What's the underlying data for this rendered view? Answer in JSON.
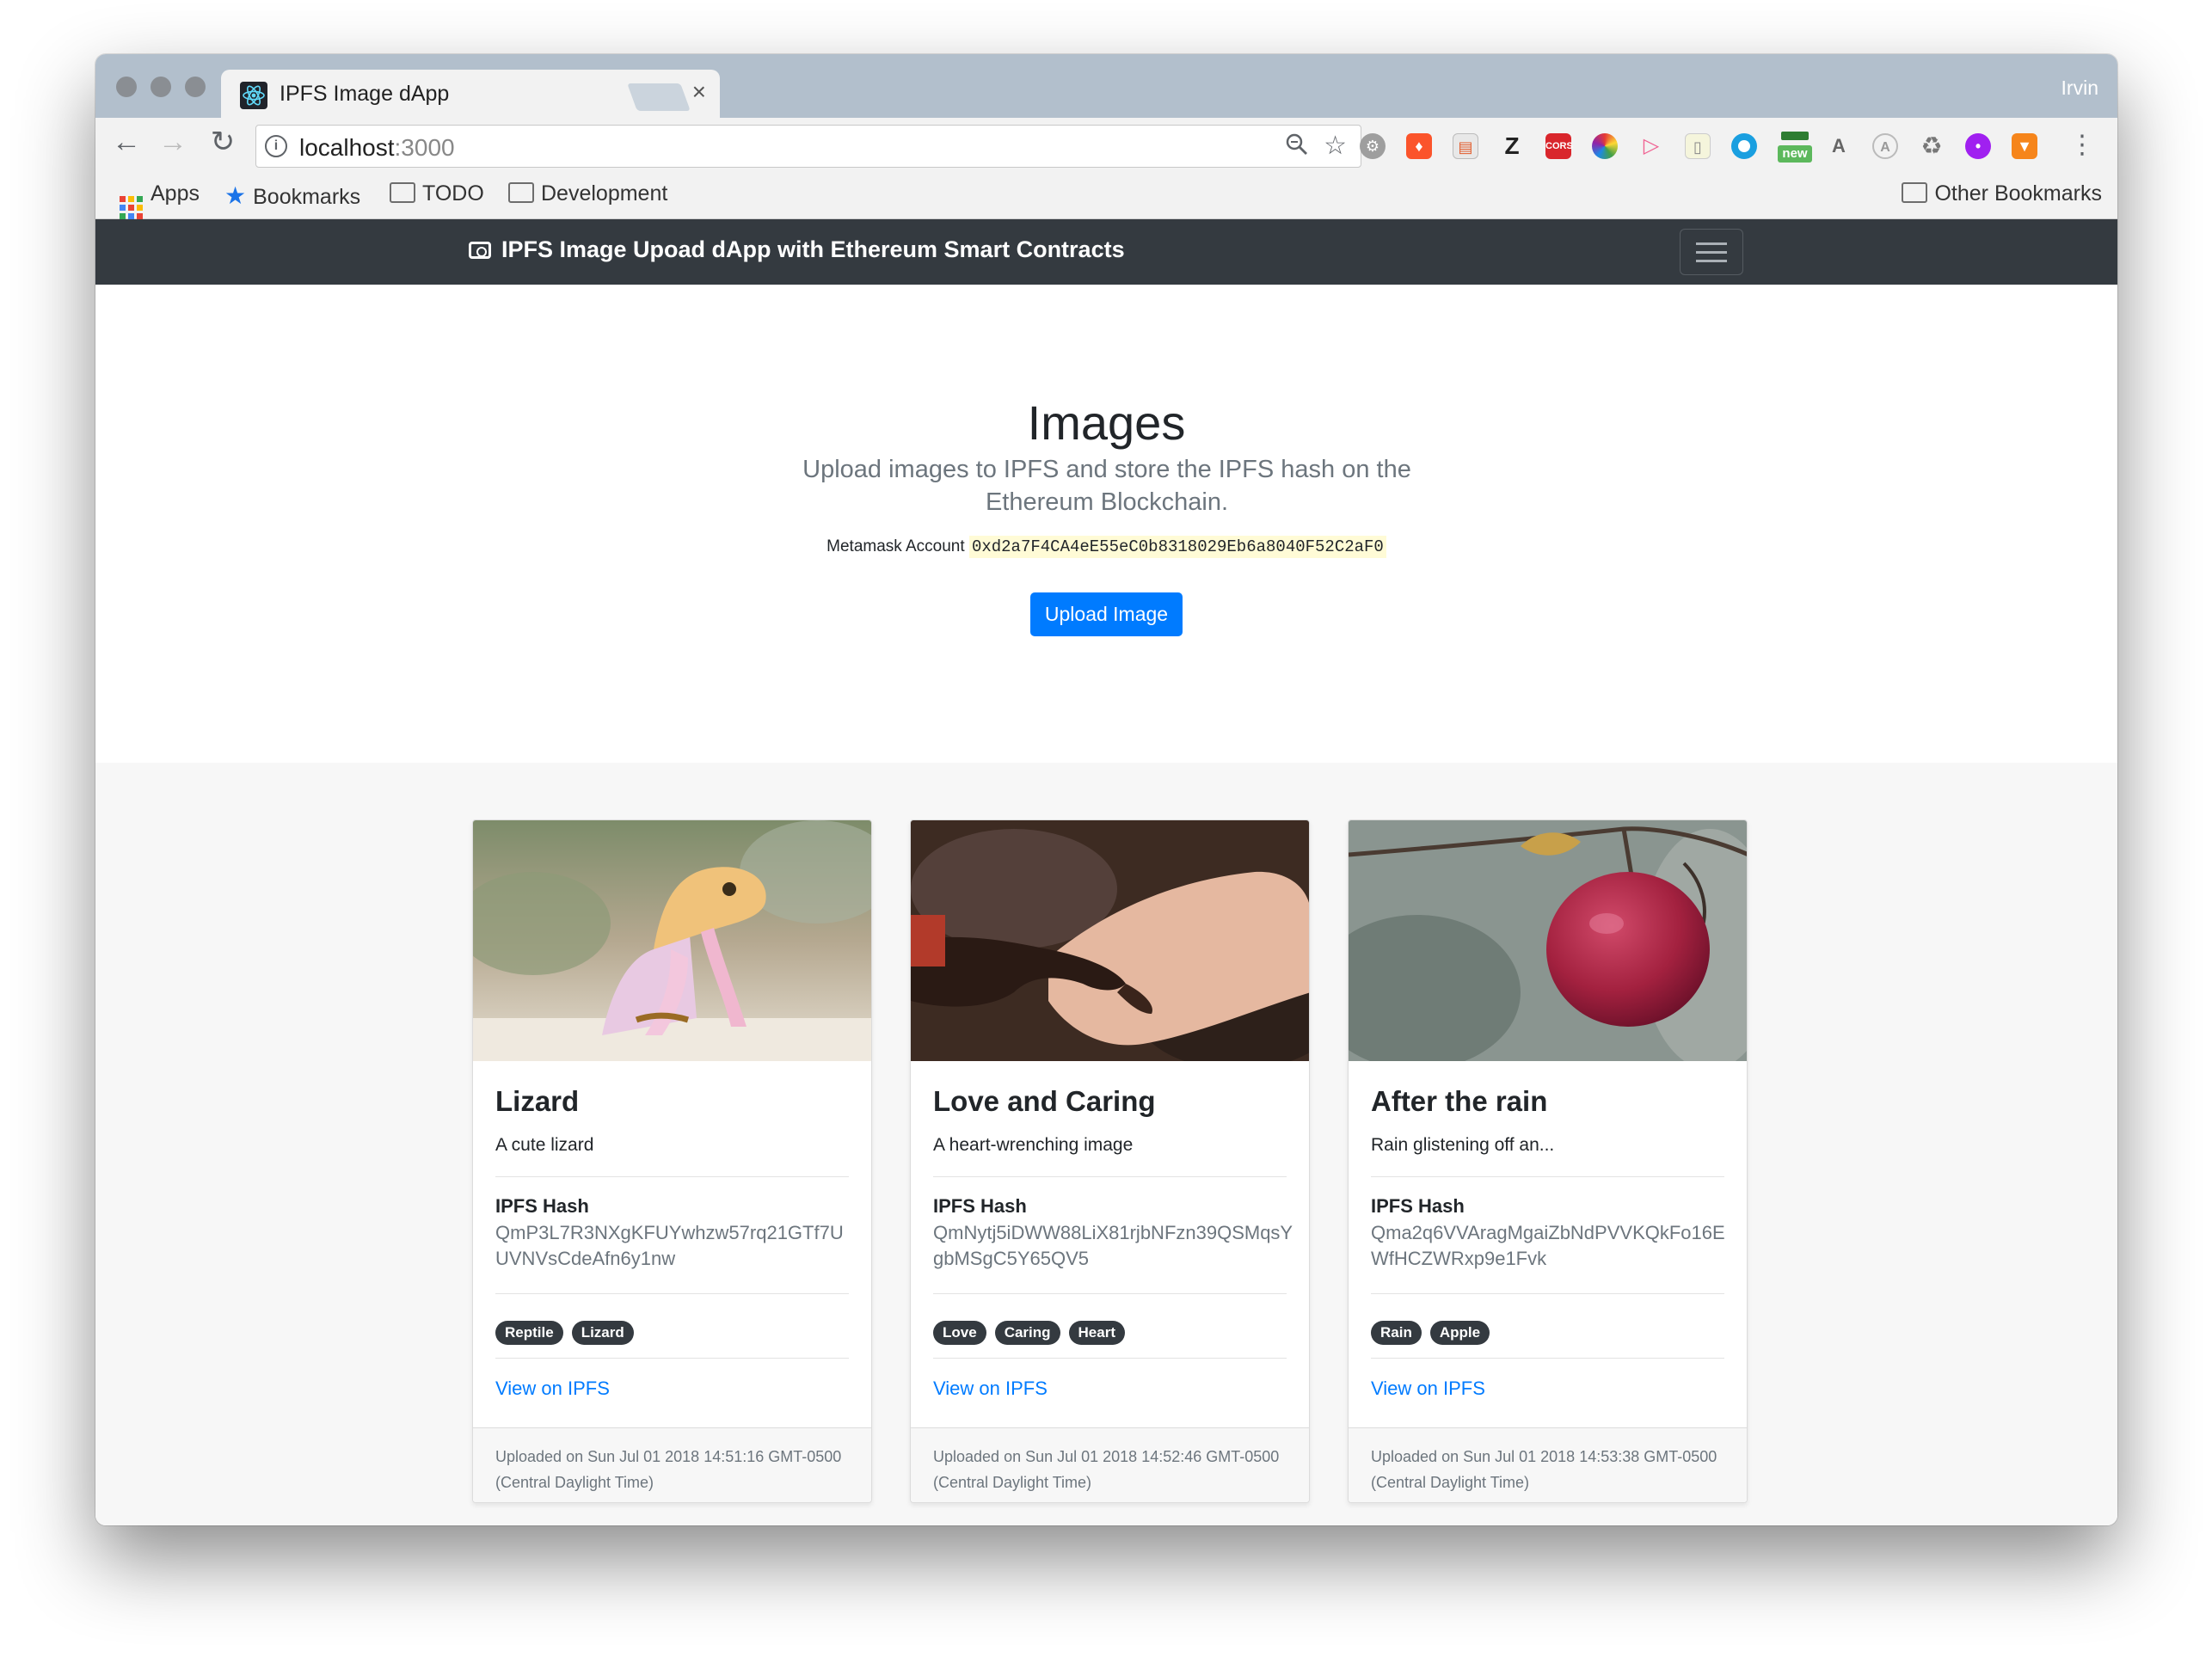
{
  "browser": {
    "tab_title": "IPFS Image dApp",
    "tab_close": "×",
    "profile_name": "Irvin",
    "url_host": "localhost",
    "url_port": ":3000",
    "bookmarks": [
      "Apps",
      "Bookmarks",
      "TODO",
      "Development"
    ],
    "other_bookmarks": "Other Bookmarks",
    "extensions": [
      "settings-ext",
      "brave-ext",
      "notes-ext",
      "Z",
      "CORS",
      "color-ext",
      "video-ext",
      "doc-ext",
      "circle-ext",
      "new",
      "translate-ext",
      "A",
      "recycle-ext",
      "purple-ext",
      "fox-ext"
    ]
  },
  "navbar": {
    "brand": "IPFS Image Upoad dApp with Ethereum Smart Contracts"
  },
  "jumbotron": {
    "heading": "Images",
    "lead": "Upload images to IPFS and store the IPFS hash on the Ethereum Blockchain.",
    "account_label": "Metamask Account",
    "account_address": "0xd2a7F4CA4eE55eC0b8318029Eb6a8040F52C2aF0",
    "upload_button": "Upload Image"
  },
  "cards": [
    {
      "title": "Lizard",
      "description": "A cute lizard",
      "hash_label": "IPFS Hash",
      "hash": "QmP3L7R3NXgKFUYwhzw57rq21GTf7UUVNVsCdeAfn6y1nw",
      "tags": [
        "Reptile",
        "Lizard"
      ],
      "link": "View on IPFS",
      "footer": "Uploaded on Sun Jul 01 2018 14:51:16 GMT-0500 (Central Daylight Time)"
    },
    {
      "title": "Love and Caring",
      "description": "A heart-wrenching image",
      "hash_label": "IPFS Hash",
      "hash": "QmNytj5iDWW88LiX81rjbNFzn39QSMqsYgbMSgC5Y65QV5",
      "tags": [
        "Love",
        "Caring",
        "Heart"
      ],
      "link": "View on IPFS",
      "footer": "Uploaded on Sun Jul 01 2018 14:52:46 GMT-0500 (Central Daylight Time)"
    },
    {
      "title": "After the rain",
      "description": "Rain glistening off an...",
      "hash_label": "IPFS Hash",
      "hash": "Qma2q6VVAragMgaiZbNdPVVKQkFo16EWfHCZWRxp9e1Fvk",
      "tags": [
        "Rain",
        "Apple"
      ],
      "link": "View on IPFS",
      "footer": "Uploaded on Sun Jul 01 2018 14:53:38 GMT-0500 (Central Daylight Time)"
    }
  ],
  "colors": {
    "primary": "#007bff",
    "navbar_bg": "#343a40",
    "badge_bg": "#343a40",
    "address_highlight": "#fffbd6"
  }
}
